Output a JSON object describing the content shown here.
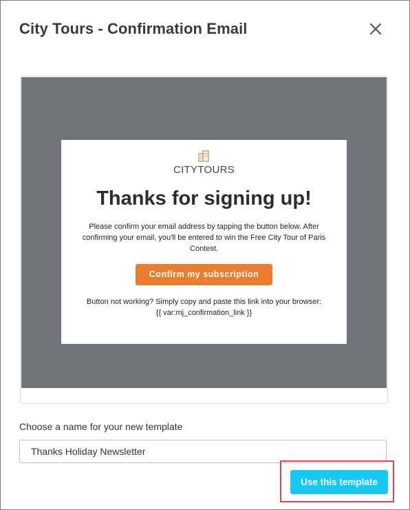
{
  "modal": {
    "title": "City Tours - Confirmation Email",
    "close_icon": "close-icon"
  },
  "preview": {
    "logo_icon": "building-icon",
    "logo_text": "CITYTOURS",
    "heading": "Thanks for signing up!",
    "body": "Please confirm your email address by tapping the button below. After confirming your email, you'll be entered to win the Free City Tour of Paris Contest.",
    "button_label": "Confirm my subscription",
    "fallback_line1": "Button not working? Simply copy and paste this link into your browser:",
    "fallback_line2": "{{ var:mj_confirmation_link }}"
  },
  "form": {
    "name_label": "Choose a name for your new template",
    "name_value": "Thanks Holiday Newsletter"
  },
  "actions": {
    "use_template_label": "Use this template"
  },
  "colors": {
    "preview_background": "#707377",
    "confirm_button": "#ec7d2f",
    "primary_button": "#18c8f3",
    "highlight": "#e0474c",
    "logo": "#d98a4a"
  }
}
